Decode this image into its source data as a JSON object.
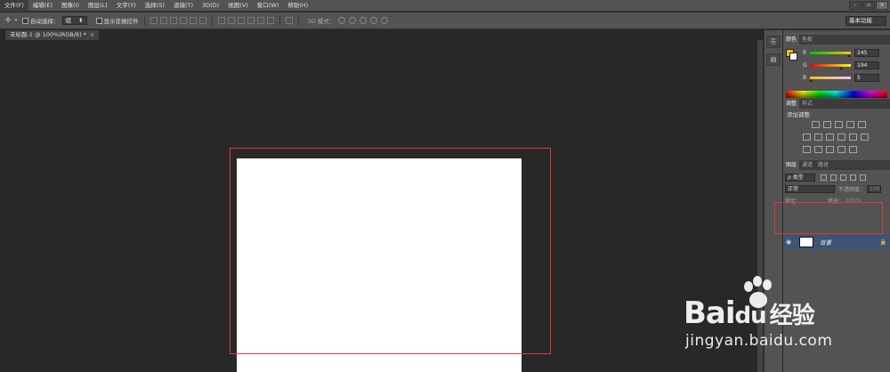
{
  "menubar": {
    "items": [
      "文件(F)",
      "编辑(E)",
      "图像(I)",
      "图层(L)",
      "文字(Y)",
      "选择(S)",
      "滤镜(T)",
      "3D(D)",
      "视图(V)",
      "窗口(W)",
      "帮助(H)"
    ]
  },
  "options": {
    "auto_select_label": "自动选择：",
    "auto_select_value": "组",
    "show_transform_label": "显示变换控件",
    "mode_3d_label": "3D 模式：",
    "workspace": "基本功能"
  },
  "document": {
    "tab_title": "未标题-1 @ 100%(RGB/8) *",
    "close_glyph": "×"
  },
  "color_panel": {
    "tabs": [
      "颜色",
      "色板"
    ],
    "channels": [
      {
        "name": "R",
        "value": "245",
        "fraction": 0.96
      },
      {
        "name": "G",
        "value": "194",
        "fraction": 0.76
      },
      {
        "name": "B",
        "value": "5",
        "fraction": 0.02
      }
    ],
    "foreground_color": "#f5c205",
    "background_color": "#ffffff"
  },
  "adjustments_panel": {
    "tabs": [
      "调整",
      "样式"
    ],
    "title": "添加调整"
  },
  "layers_panel": {
    "tabs": [
      "图层",
      "通道",
      "路径"
    ],
    "filter_label": "ρ 类型",
    "blend_mode": "正常",
    "opacity_label": "不透明度：",
    "opacity_value": "100%",
    "lock_label": "锁定：",
    "fill_label": "填充：",
    "fill_value": "100%",
    "layers": [
      {
        "name": "背景",
        "visible": true,
        "locked": true
      }
    ]
  },
  "watermark": {
    "brand": "Bai",
    "brand_suffix": "du",
    "brand_cn": "经验",
    "url": "jingyan.baidu.com"
  },
  "colors": {
    "highlight": "#e0383a",
    "selected_layer": "#3d5476",
    "ui_gray": "#535353",
    "workspace_bg": "#282828"
  }
}
